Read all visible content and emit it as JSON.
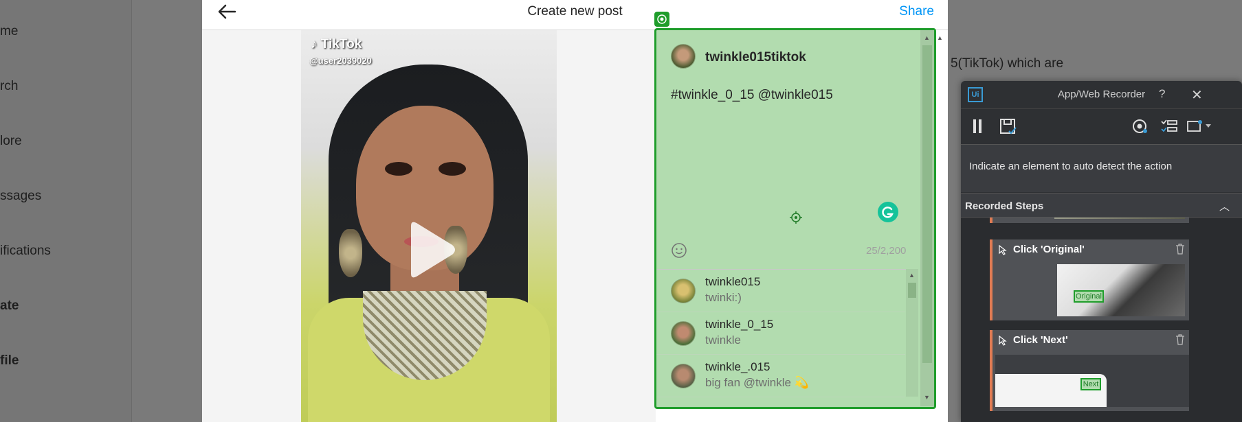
{
  "background": {
    "nav_items": [
      "me",
      "rch",
      "lore",
      "ssages",
      "ifications",
      "ate",
      "file"
    ],
    "right_text": "5(TikTok) which are"
  },
  "modal": {
    "title": "Create new post",
    "share_label": "Share",
    "video": {
      "platform_logo": "TikTok",
      "handle": "@user2039020"
    },
    "caption_panel": {
      "username": "twinkle015tiktok",
      "caption": "#twinkle_0_15 @twinkle015",
      "char_count": "25/2,200"
    },
    "mention_suggestions": [
      {
        "name": "twinkle015",
        "subtitle": "twinki:)"
      },
      {
        "name": "twinkle_0_15",
        "subtitle": "twinkle"
      },
      {
        "name": "twinkle_.015",
        "subtitle": "big fan @twinkle 💫"
      }
    ]
  },
  "recorder": {
    "logo_text": "Ui",
    "title": "App/Web Recorder",
    "help_label": "?",
    "close_label": "✕",
    "hint": "Indicate an element to auto detect the action",
    "steps_header": "Recorded Steps",
    "steps": [
      {
        "title": "Click 'Original'",
        "thumb_label": "Original"
      },
      {
        "title": "Click 'Next'",
        "thumb_label": "Next"
      }
    ]
  },
  "colors": {
    "accent_blue": "#0095f6",
    "highlight_green": "#1f9d2b",
    "highlight_fill": "#b2dcaf",
    "recorder_bg": "#2e3033",
    "step_accent": "#e07b53"
  }
}
